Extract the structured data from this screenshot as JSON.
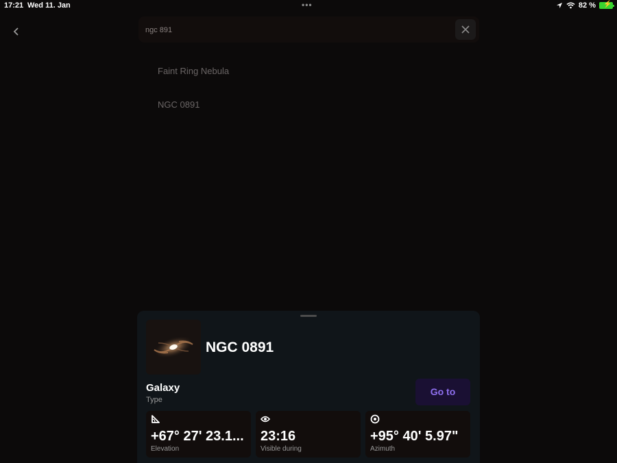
{
  "status_bar": {
    "time": "17:21",
    "date": "Wed 11. Jan",
    "battery_text": "82 %",
    "icons": [
      "location-icon",
      "wifi-icon",
      "battery-charging-icon"
    ]
  },
  "search": {
    "query": "ngc 891",
    "clear_icon": "close-icon"
  },
  "results": [
    {
      "label": "Faint Ring Nebula"
    },
    {
      "label": "NGC 0891"
    }
  ],
  "detail": {
    "name": "NGC 0891",
    "thumbnail": "spiral-galaxy-image",
    "type_value": "Galaxy",
    "type_label": "Type",
    "goto_label": "Go to",
    "stats": [
      {
        "icon": "elevation-angle-icon",
        "value": "+67° 27' 23.1...",
        "label": "Elevation"
      },
      {
        "icon": "eye-icon",
        "value": "23:16",
        "label": "Visible during"
      },
      {
        "icon": "compass-target-icon",
        "value": "+95° 40' 5.97\"",
        "label": "Azimuth"
      }
    ]
  },
  "colors": {
    "background": "#0c0a0a",
    "sheet": "#101519",
    "accent": "#8f70f0",
    "goto_bg": "#1a1033",
    "battery": "#38d430"
  }
}
